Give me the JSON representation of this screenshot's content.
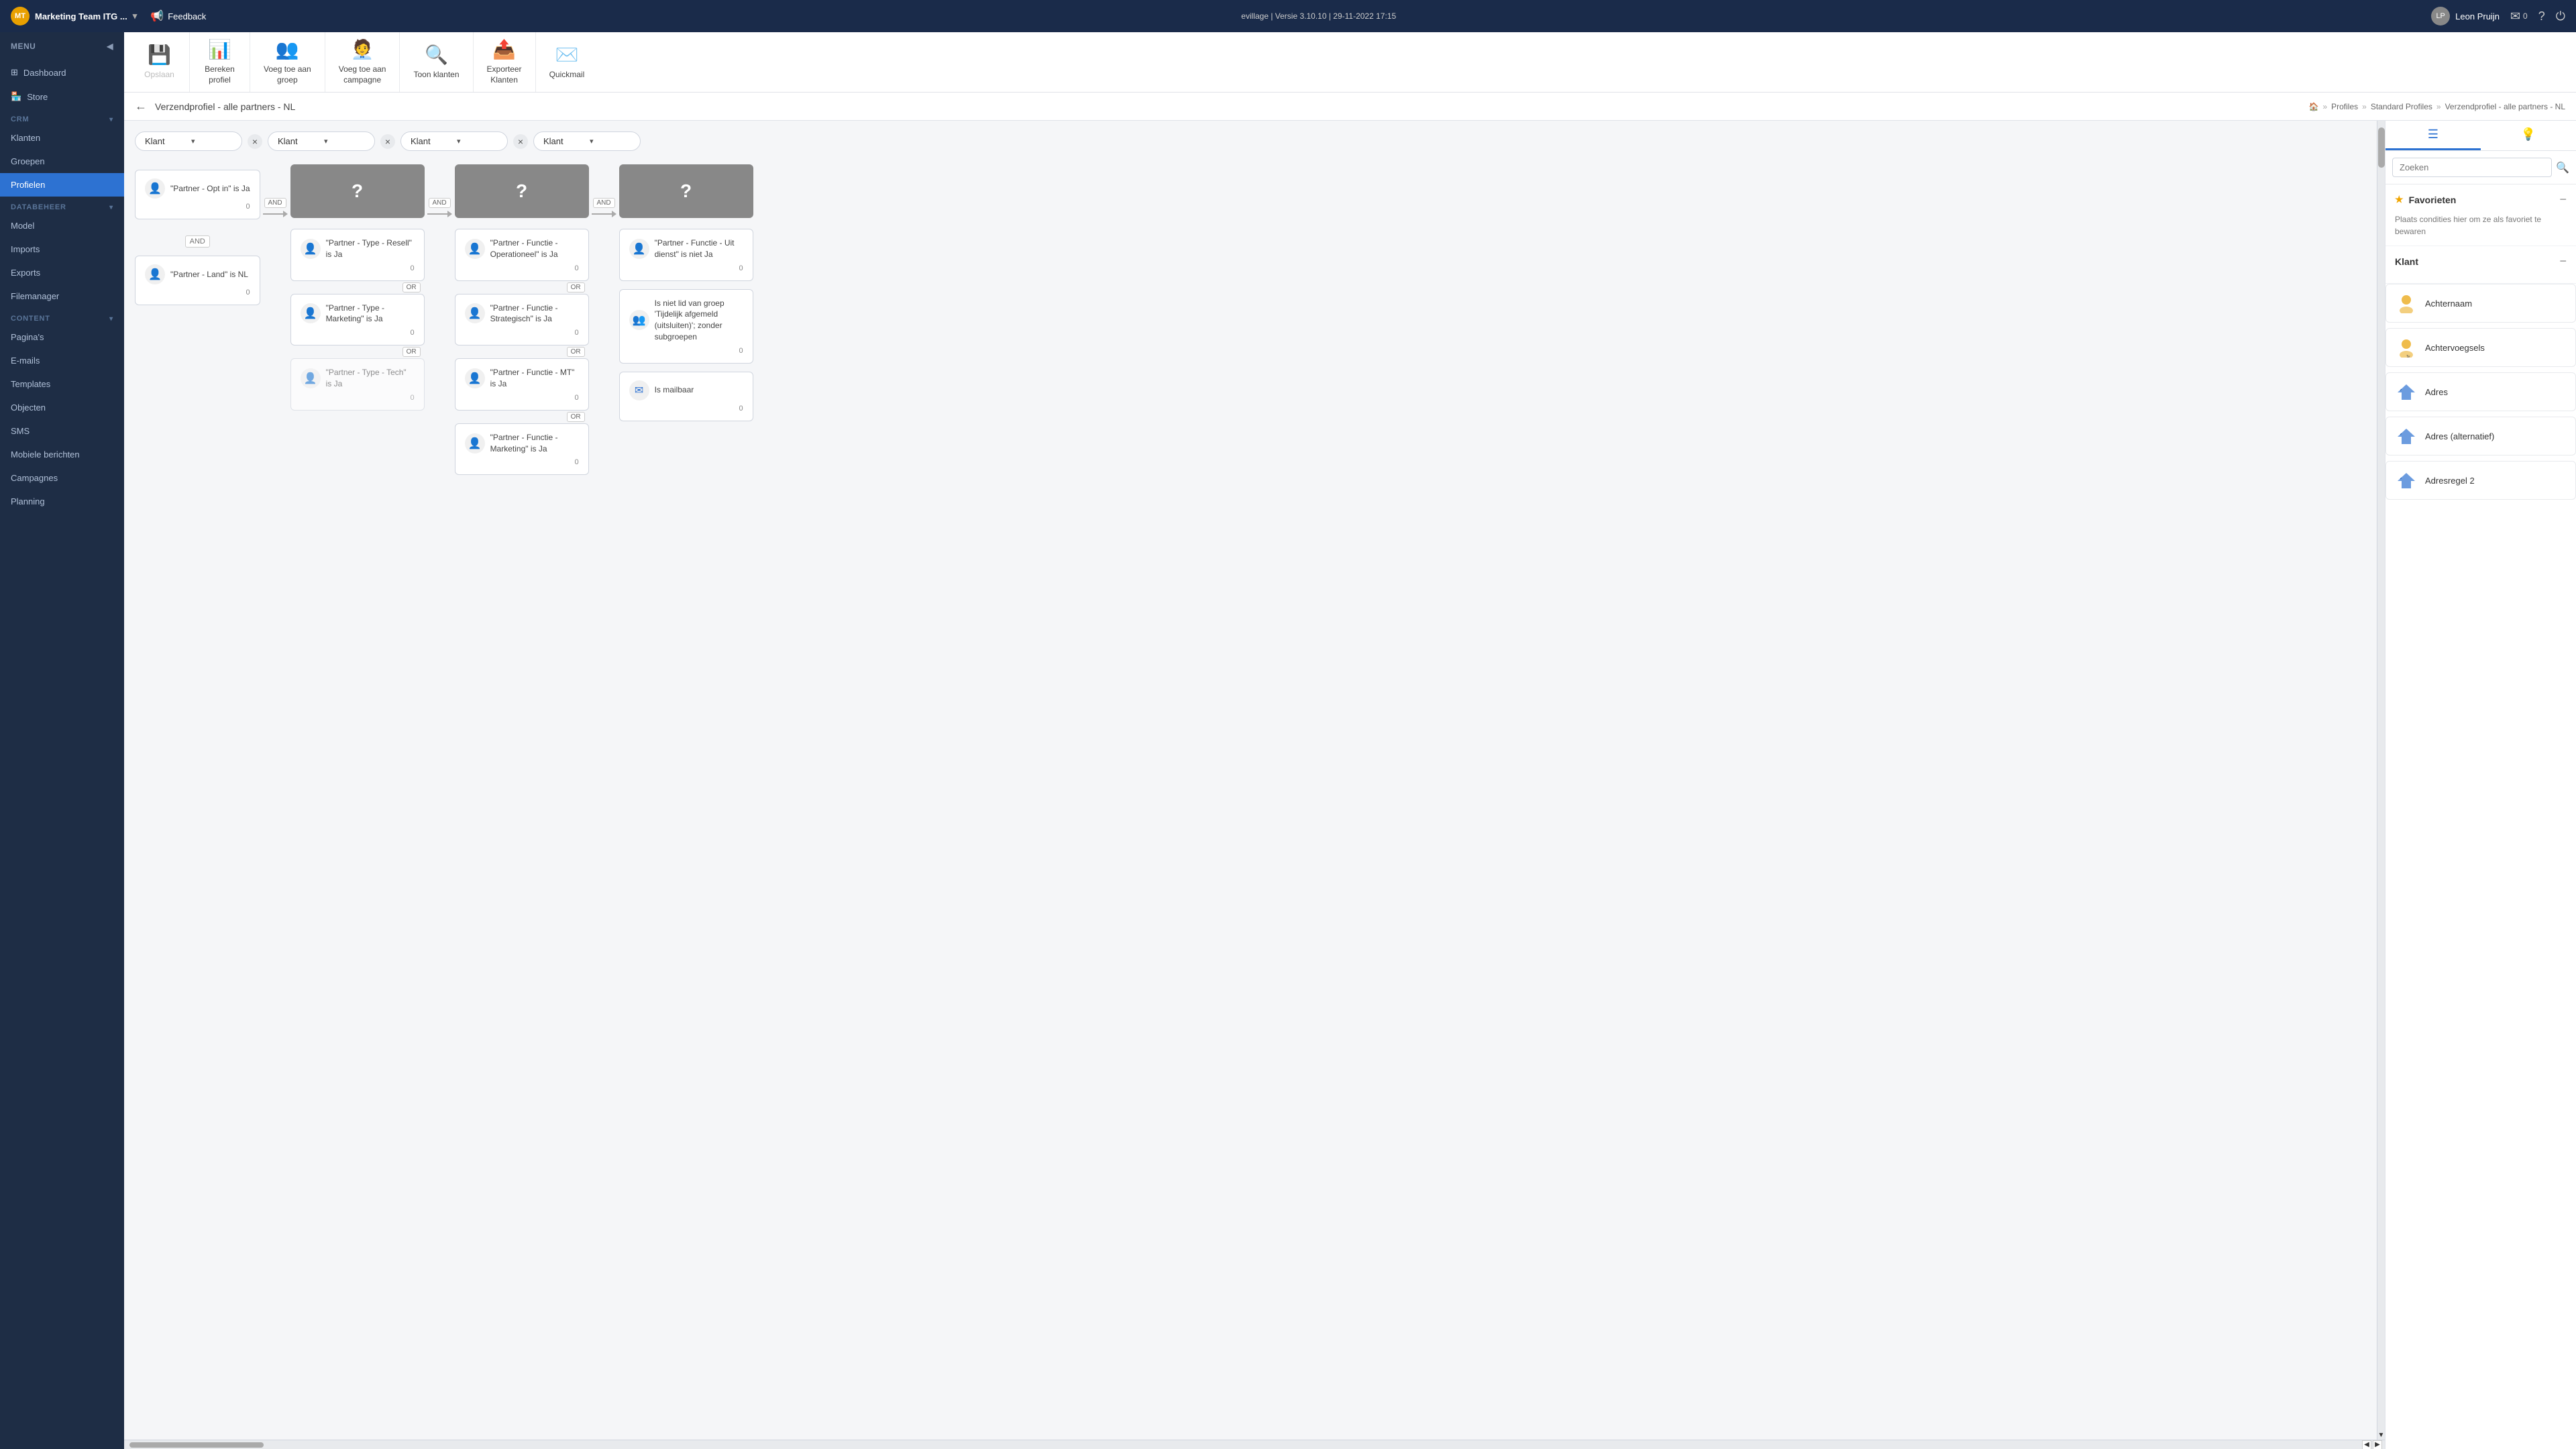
{
  "topbar": {
    "team_name": "Marketing Team ITG ...",
    "feedback_label": "Feedback",
    "version_info": "evillage | Versie 3.10.10 | 29-11-2022 17:15",
    "user_name": "Leon Pruijn",
    "mail_count": "0"
  },
  "sidebar": {
    "menu_label": "MENU",
    "items": [
      {
        "id": "dashboard",
        "label": "Dashboard"
      },
      {
        "id": "store",
        "label": "Store"
      }
    ],
    "sections": [
      {
        "label": "CRM",
        "items": [
          {
            "id": "klanten",
            "label": "Klanten"
          },
          {
            "id": "groepen",
            "label": "Groepen"
          },
          {
            "id": "profielen",
            "label": "Profielen",
            "active": true
          }
        ]
      },
      {
        "label": "DATABEHEER",
        "items": [
          {
            "id": "model",
            "label": "Model"
          },
          {
            "id": "imports",
            "label": "Imports"
          },
          {
            "id": "exports",
            "label": "Exports"
          },
          {
            "id": "filemanager",
            "label": "Filemanager"
          }
        ]
      },
      {
        "label": "CONTENT",
        "items": [
          {
            "id": "paginas",
            "label": "Pagina's"
          },
          {
            "id": "emails",
            "label": "E-mails"
          },
          {
            "id": "templates",
            "label": "Templates"
          },
          {
            "id": "objecten",
            "label": "Objecten"
          },
          {
            "id": "sms",
            "label": "SMS"
          },
          {
            "id": "mobiele_berichten",
            "label": "Mobiele berichten"
          },
          {
            "id": "campagnes",
            "label": "Campagnes"
          },
          {
            "id": "planning",
            "label": "Planning"
          }
        ]
      }
    ]
  },
  "toolbar": {
    "items": [
      {
        "id": "opslaan",
        "label": "Opslaan",
        "icon": "💾",
        "disabled": true
      },
      {
        "id": "bereken_profiel",
        "label": "Bereken\nprofiel",
        "icon": "📊"
      },
      {
        "id": "voeg_groep",
        "label": "Voeg toe aan\ngroep",
        "icon": "👥"
      },
      {
        "id": "voeg_campagne",
        "label": "Voeg toe aan\ncampagne",
        "icon": "👤"
      },
      {
        "id": "toon_klanten",
        "label": "Toon klanten",
        "icon": "🔍"
      },
      {
        "id": "exporteer",
        "label": "Exporteer\nKlanten",
        "icon": "📤"
      },
      {
        "id": "quickmail",
        "label": "Quickmail",
        "icon": "✉️"
      }
    ]
  },
  "page": {
    "title": "Verzendprofiel - alle partners - NL",
    "breadcrumbs": [
      "Profiles",
      "Standard Profiles",
      "Verzendprofiel - alle partners - NL"
    ]
  },
  "filters": [
    {
      "value": "Klant"
    },
    {
      "value": "Klant"
    },
    {
      "value": "Klant"
    },
    {
      "value": "Klant"
    }
  ],
  "flow_nodes": {
    "col1": [
      {
        "text": "\"Partner - Opt in\" is Ja",
        "count": "0"
      },
      {
        "text": "\"Partner - Land\" is NL",
        "count": "0"
      }
    ],
    "col2_placeholder": "?",
    "col2_nodes": [
      {
        "text": "\"Partner - Type - Resell\" is Ja",
        "count": "0"
      },
      {
        "text": "\"Partner - Type - Marketing\" is Ja",
        "count": "0"
      },
      {
        "text": "\"Partner - Type - Tech\" is Ja",
        "count": "0"
      }
    ],
    "col3_placeholder": "?",
    "col3_nodes": [
      {
        "text": "\"Partner - Functie - Operationeel\" is Ja",
        "count": "0"
      },
      {
        "text": "\"Partner - Functie - Strategisch\" is Ja",
        "count": "0"
      },
      {
        "text": "\"Partner - Functie - MT\" is Ja",
        "count": "0"
      },
      {
        "text": "\"Partner - Functie - Marketing\" is Ja",
        "count": "0"
      }
    ],
    "col4_placeholder": "?",
    "col4_nodes": [
      {
        "text": "\"Partner - Functie - Uit dienst\" is niet Ja",
        "count": "0"
      },
      {
        "text": "Is niet lid van groep 'Tijdelijk afgemeld (uitsluiten)'; zonder subgroepen",
        "count": "0",
        "icon": "group"
      },
      {
        "text": "Is mailbaar",
        "count": "0",
        "icon": "mail"
      }
    ]
  },
  "right_panel": {
    "search_placeholder": "Zoeken",
    "favorites_title": "Favorieten",
    "favorites_text": "Plaats condities hier om ze als favoriet te bewaren",
    "klant_title": "Klant",
    "items": [
      {
        "id": "achternaam",
        "label": "Achternaam",
        "icon": "person"
      },
      {
        "id": "achtervoegsels",
        "label": "Achtervoegsels",
        "icon": "person"
      },
      {
        "id": "adres",
        "label": "Adres",
        "icon": "house"
      },
      {
        "id": "adres_alt",
        "label": "Adres (alternatief)",
        "icon": "house"
      },
      {
        "id": "adresregel2",
        "label": "Adresregel 2",
        "icon": "house"
      }
    ]
  }
}
